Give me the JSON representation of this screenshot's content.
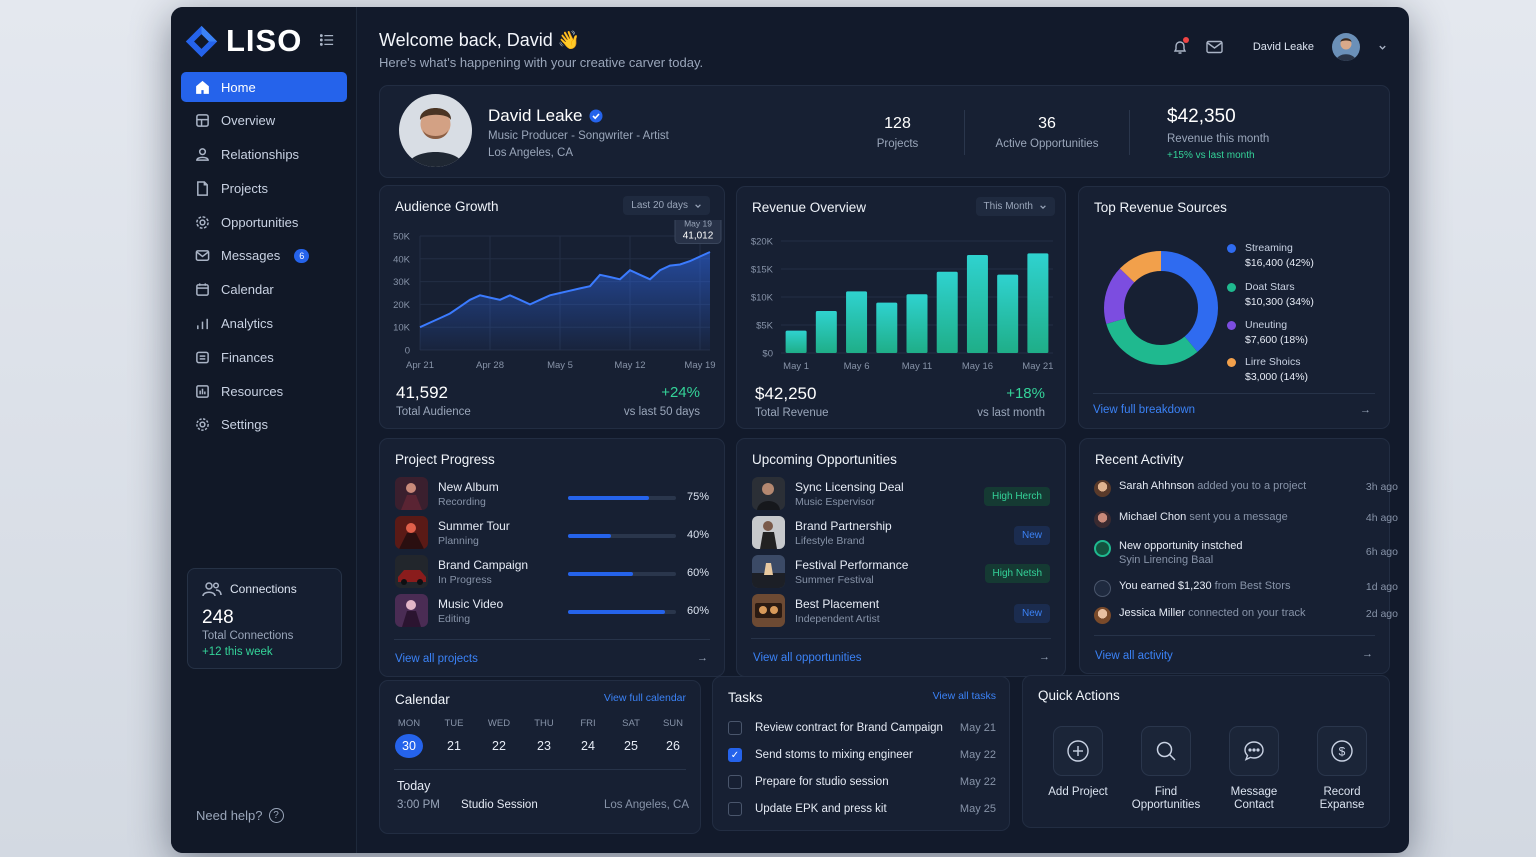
{
  "app": {
    "name": "LISO"
  },
  "nav": [
    {
      "label": "Home",
      "icon": "home-icon"
    },
    {
      "label": "Overview",
      "icon": "grid-icon"
    },
    {
      "label": "Relationships",
      "icon": "user-icon"
    },
    {
      "label": "Projects",
      "icon": "file-icon"
    },
    {
      "label": "Opportunities",
      "icon": "gear-icon"
    },
    {
      "label": "Messages",
      "icon": "mail-icon",
      "badge": "6"
    },
    {
      "label": "Calendar",
      "icon": "calendar-icon"
    },
    {
      "label": "Analytics",
      "icon": "bar-chart-icon"
    },
    {
      "label": "Finances",
      "icon": "wallet-icon"
    },
    {
      "label": "Resources",
      "icon": "book-icon"
    },
    {
      "label": "Settings",
      "icon": "settings-icon"
    }
  ],
  "connections": {
    "title": "Connections",
    "value": "248",
    "label": "Total Connections",
    "delta": "+12 this week"
  },
  "help": {
    "label": "Need help?"
  },
  "header": {
    "title": "Welcome back, David",
    "emoji": "👋",
    "subtitle": "Here's what's happening with your creative carver today.",
    "user_name": "David Leake"
  },
  "profile": {
    "name": "David Leake",
    "role": "Music Producer - Songwriter - Artist",
    "location": "Los Angeles, CA",
    "projects": {
      "value": "128",
      "label": "Projects"
    },
    "opportunities": {
      "value": "36",
      "label": "Active Opportunities"
    },
    "revenue": {
      "value": "$42,350",
      "label": "Revenue this month",
      "delta": "+15% vs last month"
    }
  },
  "audience": {
    "title": "Audience Growth",
    "range": "Last 20 days",
    "tooltip_date": "May 19",
    "tooltip_value": "41,012",
    "total": "41,592",
    "total_label": "Total Audience",
    "delta": "+24%",
    "delta_label": "vs last 50 days"
  },
  "revenue_overview": {
    "title": "Revenue Overview",
    "range": "This Month",
    "total": "$42,250",
    "total_label": "Total Revenue",
    "delta": "+18%",
    "delta_label": "vs last month"
  },
  "top_sources": {
    "title": "Top Revenue Sources",
    "link": "View full breakdown",
    "items": [
      {
        "name": "Streaming",
        "value": "$16,400 (42%)",
        "color": "#2f6bf0"
      },
      {
        "name": "Doat Stars",
        "value": "$10,300 (34%)",
        "color": "#1fb98f"
      },
      {
        "name": "Uneuting",
        "value": "$7,600 (18%)",
        "color": "#7c4de0"
      },
      {
        "name": "Lirre Shoics",
        "value": "$3,000 (14%)",
        "color": "#f2a04b"
      }
    ]
  },
  "project_progress": {
    "title": "Project Progress",
    "link": "View all projects",
    "items": [
      {
        "name": "New Album",
        "status": "Recording",
        "pct": "75%",
        "value": 0.75
      },
      {
        "name": "Summer Tour",
        "status": "Planning",
        "pct": "40%",
        "value": 0.4
      },
      {
        "name": "Brand Campaign",
        "status": "In Progress",
        "pct": "60%",
        "value": 0.6
      },
      {
        "name": "Music Video",
        "status": "Editing",
        "pct": "60%",
        "value": 0.9
      }
    ]
  },
  "opportunities": {
    "title": "Upcoming Opportunities",
    "link": "View all opportunities",
    "items": [
      {
        "name": "Sync Licensing Deal",
        "sub": "Music Espervisor",
        "tag": "High Herch",
        "tag_type": "green"
      },
      {
        "name": "Brand Partnership",
        "sub": "Lifestyle Brand",
        "tag": "New",
        "tag_type": "blue"
      },
      {
        "name": "Festival Performance",
        "sub": "Summer Festival",
        "tag": "High Netsh",
        "tag_type": "green"
      },
      {
        "name": "Best Placement",
        "sub": "Independent Artist",
        "tag": "New",
        "tag_type": "blue"
      }
    ]
  },
  "activity": {
    "title": "Recent Activity",
    "link": "View all activity",
    "items": [
      {
        "who": "Sarah Ahhnson",
        "what": "added you to a project",
        "sub": "",
        "time": "3h ago"
      },
      {
        "who": "Michael Chon",
        "what": "sent you a message",
        "sub": "",
        "time": "4h ago"
      },
      {
        "who": "New opportunity instched",
        "what": "",
        "sub": "Syin Lirencing Baal",
        "time": "6h ago"
      },
      {
        "who": "You earned $1,230",
        "what": "from Best Stors",
        "sub": "",
        "time": "1d ago"
      },
      {
        "who": "Jessica Miller",
        "what": "connected on your track",
        "sub": "",
        "time": "2d ago"
      }
    ]
  },
  "calendar": {
    "title": "Calendar",
    "link": "View full calendar",
    "days": [
      {
        "label": "MON",
        "num": "30"
      },
      {
        "label": "TUE",
        "num": "21"
      },
      {
        "label": "WED",
        "num": "22"
      },
      {
        "label": "THU",
        "num": "23"
      },
      {
        "label": "FRI",
        "num": "24"
      },
      {
        "label": "SAT",
        "num": "25"
      },
      {
        "label": "SUN",
        "num": "26"
      }
    ],
    "today_label": "Today",
    "event_time": "3:00 PM",
    "event_name": "Studio Session",
    "event_place": "Los Angeles, CA"
  },
  "tasks": {
    "title": "Tasks",
    "link": "View all tasks",
    "items": [
      {
        "text": "Review contract for Brand Campaign",
        "date": "May 21",
        "done": false
      },
      {
        "text": "Send stoms to mixing engineer",
        "date": "May 22",
        "done": true
      },
      {
        "text": "Prepare for studio session",
        "date": "May 22",
        "done": false
      },
      {
        "text": "Update EPK and press kit",
        "date": "May 25",
        "done": false
      }
    ]
  },
  "quick_actions": {
    "title": "Quick Actions",
    "items": [
      {
        "label": "Add Project",
        "icon": "plus-icon"
      },
      {
        "label": "Find Opportunities",
        "icon": "search-icon"
      },
      {
        "label": "Message Contact",
        "icon": "chat-icon"
      },
      {
        "label": "Record Expanse",
        "icon": "dollar-icon"
      }
    ]
  },
  "chart_data": [
    {
      "type": "area",
      "title": "Audience Growth",
      "x": [
        "Apr 21",
        "",
        "",
        "",
        "",
        "",
        "",
        "Apr 28",
        "",
        "",
        "",
        "",
        "",
        "",
        "May 5",
        "",
        "",
        "",
        "",
        "",
        "",
        "May 12",
        "",
        "",
        "",
        "",
        "",
        "",
        "May 19",
        ""
      ],
      "xticks": [
        "Apr 21",
        "Apr 28",
        "May 5",
        "May 12",
        "May 19"
      ],
      "yticks": [
        "0",
        "10K",
        "20K",
        "30K",
        "40K",
        "50K"
      ],
      "ylim": [
        0,
        50000
      ],
      "values": [
        10000,
        12000,
        14000,
        16000,
        19000,
        22000,
        24000,
        23000,
        22000,
        24000,
        22000,
        20000,
        22000,
        24000,
        25000,
        26000,
        27000,
        28000,
        33000,
        32000,
        31000,
        35000,
        33000,
        31000,
        35000,
        37000,
        37500,
        39000,
        41012,
        43000
      ],
      "color": "#2f6bf0"
    },
    {
      "type": "bar",
      "title": "Revenue Overview",
      "categories": [
        "May 1",
        "",
        "May 6",
        "",
        "May 11",
        "",
        "May 16",
        "",
        "May 21"
      ],
      "xticks": [
        "May 1",
        "May 6",
        "May 11",
        "May 16",
        "May 21"
      ],
      "yticks": [
        "$0",
        "$5K",
        "$10K",
        "$15K",
        "$20K"
      ],
      "ylim": [
        0,
        20000
      ],
      "values": [
        4000,
        7500,
        11000,
        9000,
        10500,
        14500,
        17500,
        14000,
        17800
      ]
    },
    {
      "type": "pie",
      "title": "Top Revenue Sources",
      "labels": [
        "Streaming",
        "Doat Stars",
        "Uneuting",
        "Lirre Shoics"
      ],
      "values": [
        42,
        34,
        18,
        14
      ]
    }
  ]
}
